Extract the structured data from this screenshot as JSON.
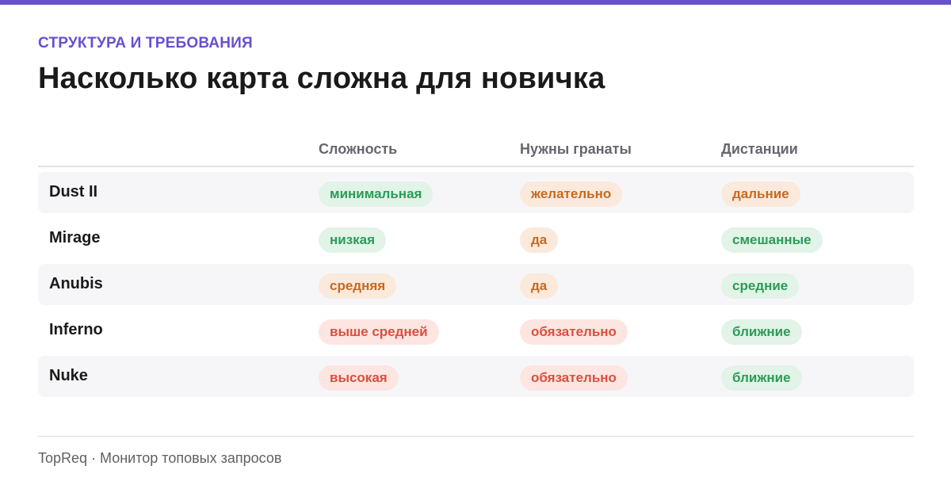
{
  "header": {
    "kicker": "СТРУКТУРА И ТРЕБОВАНИЯ",
    "title": "Насколько карта сложна для новичка"
  },
  "table": {
    "columns": [
      "Сложность",
      "Нужны гранаты",
      "Дистанции"
    ],
    "rows": [
      {
        "name": "Dust II",
        "difficulty": "минимальная",
        "grenades": "желательно",
        "distances": "дальние"
      },
      {
        "name": "Mirage",
        "difficulty": "низкая",
        "grenades": "да",
        "distances": "смешанные"
      },
      {
        "name": "Anubis",
        "difficulty": "средняя",
        "grenades": "да",
        "distances": "средние"
      },
      {
        "name": "Inferno",
        "difficulty": "выше средней",
        "grenades": "обязательно",
        "distances": "ближние"
      },
      {
        "name": "Nuke",
        "difficulty": "высокая",
        "grenades": "обязательно",
        "distances": "ближние"
      }
    ],
    "tones": [
      [
        "green",
        "orange",
        "orange"
      ],
      [
        "green",
        "orange",
        "green"
      ],
      [
        "orange",
        "orange",
        "green"
      ],
      [
        "red",
        "red",
        "green"
      ],
      [
        "red",
        "red",
        "green"
      ]
    ]
  },
  "footer": {
    "text": "TopReq · Монитор топовых запросов"
  },
  "colors": {
    "accent": "#6a4fd0",
    "green": "#2c9b56",
    "orange": "#c46a22",
    "red": "#d8503e"
  }
}
